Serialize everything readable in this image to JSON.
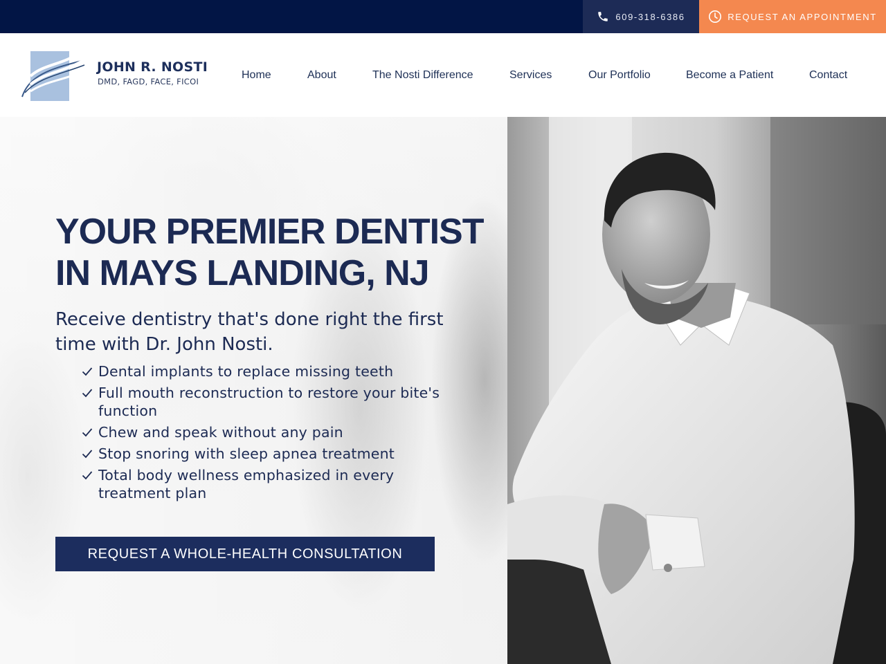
{
  "topbar": {
    "phone_icon": "phone-icon",
    "phone": "609-318-6386",
    "clock_icon": "clock-icon",
    "appointment_label": "REQUEST AN APPOINTMENT"
  },
  "logo": {
    "name": "JOHN R. NOSTI",
    "credentials": "DMD, FAGD, FACE, FICOI"
  },
  "nav": {
    "items": [
      "Home",
      "About",
      "The Nosti Difference",
      "Services",
      "Our Portfolio",
      "Become a Patient",
      "Contact"
    ]
  },
  "hero": {
    "title_line1": "YOUR PREMIER DENTIST",
    "title_line2": "IN MAYS LANDING, NJ",
    "subtitle": "Receive dentistry that's done right the first time with Dr. John Nosti.",
    "checklist": [
      "Dental implants to replace missing teeth",
      "Full mouth reconstruction to restore your bite's function",
      "Chew and speak without any pain",
      "Stop snoring with sleep apnea treatment",
      "Total body wellness emphasized in every treatment plan"
    ],
    "check_icon": "checkmark-icon",
    "cta_label": "REQUEST A WHOLE-HEALTH CONSULTATION"
  },
  "colors": {
    "navy": "#021545",
    "accent_orange": "#f4884f",
    "text_navy": "#1c2a53",
    "cta_navy": "#1c2d5e"
  }
}
